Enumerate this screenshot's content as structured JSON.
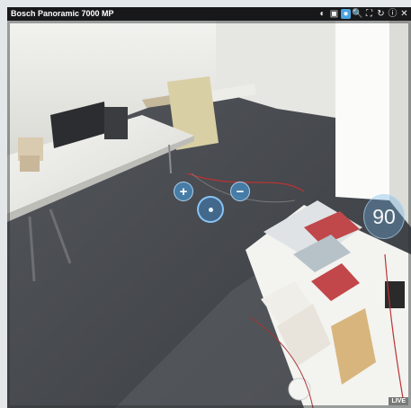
{
  "camera": {
    "title": "Bosch Panoramic 7000 MP"
  },
  "toolbar": {
    "buttons": [
      {
        "name": "contrast",
        "glyph": "◐"
      },
      {
        "name": "snapshot",
        "glyph": "▣"
      },
      {
        "name": "view-mode",
        "glyph": "●"
      },
      {
        "name": "zoom",
        "glyph": "🔍"
      },
      {
        "name": "fullscreen",
        "glyph": "⛶"
      },
      {
        "name": "rotate",
        "glyph": "↻"
      },
      {
        "name": "info",
        "glyph": "ⓘ"
      },
      {
        "name": "close",
        "glyph": "✕"
      }
    ]
  },
  "ptz": {
    "zoom_in": "+",
    "zoom_out": "−"
  },
  "angle_readout": "90",
  "status": {
    "live": "LIVE"
  },
  "colors": {
    "accent": "#4aa3df",
    "titlebar": "#141416"
  }
}
